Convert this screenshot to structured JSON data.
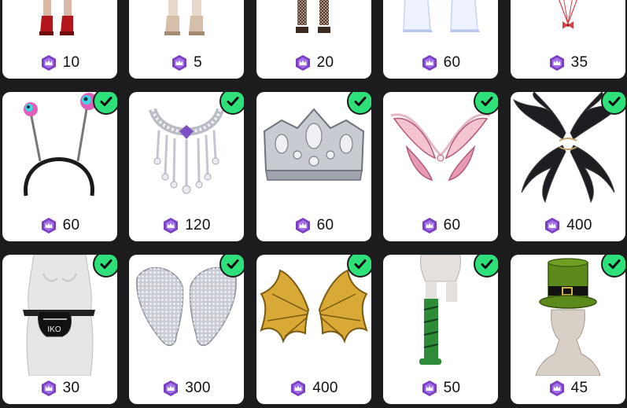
{
  "colors": {
    "background": "#1c1c1e",
    "card": "#ffffff",
    "coin": "#7b3fc4",
    "owned_check": "#2ee07a"
  },
  "currency_icon": "purple-crown-coin-icon",
  "owned_icon": "checkmark-icon",
  "items": [
    {
      "name": "red-boots-item",
      "price": "10",
      "owned": false
    },
    {
      "name": "beige-boots-item",
      "price": "5",
      "owned": false
    },
    {
      "name": "fishnet-boots-item",
      "price": "20",
      "owned": false
    },
    {
      "name": "white-pants-item",
      "price": "60",
      "owned": false
    },
    {
      "name": "red-bow-string-item",
      "price": "35",
      "owned": false
    },
    {
      "name": "alien-antenna-headband-item",
      "price": "60",
      "owned": true
    },
    {
      "name": "diamond-necklace-item",
      "price": "120",
      "owned": true
    },
    {
      "name": "silver-crown-item",
      "price": "60",
      "owned": true
    },
    {
      "name": "pink-fairy-wings-necklace-item",
      "price": "60",
      "owned": true
    },
    {
      "name": "black-feather-wings-item",
      "price": "400",
      "owned": true
    },
    {
      "name": "black-fanny-pack-item",
      "price": "30",
      "owned": true
    },
    {
      "name": "silver-angel-wings-item",
      "price": "300",
      "owned": true
    },
    {
      "name": "gold-dragon-wings-item",
      "price": "400",
      "owned": true
    },
    {
      "name": "green-striped-stockings-item",
      "price": "50",
      "owned": true
    },
    {
      "name": "green-top-hat-item",
      "price": "45",
      "owned": true
    }
  ]
}
